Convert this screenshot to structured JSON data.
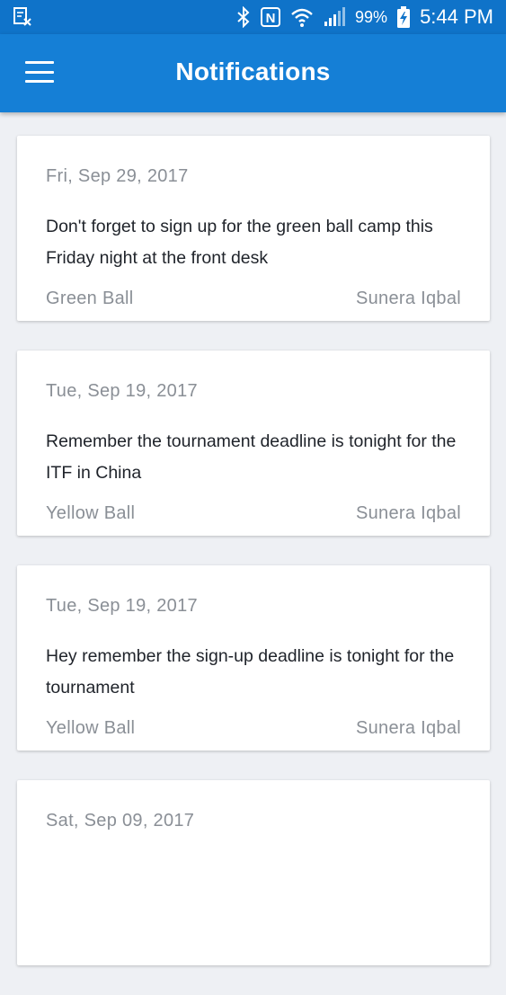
{
  "status_bar": {
    "battery": "99%",
    "time": "5:44 PM",
    "nfc_letter": "N"
  },
  "app_bar": {
    "title": "Notifications"
  },
  "notifications": [
    {
      "date": "Fri, Sep 29, 2017",
      "message": "Don't forget to sign up for the green ball camp this Friday night at the front desk",
      "group": "Green Ball",
      "author": "Sunera Iqbal"
    },
    {
      "date": "Tue, Sep 19, 2017",
      "message": "Remember the tournament deadline is tonight for the ITF in China",
      "group": "Yellow Ball",
      "author": "Sunera Iqbal"
    },
    {
      "date": "Tue, Sep 19, 2017",
      "message": "Hey remember the sign-up deadline is tonight for the tournament",
      "group": "Yellow Ball",
      "author": "Sunera Iqbal"
    },
    {
      "date": "Sat, Sep 09, 2017",
      "message": "",
      "group": "",
      "author": ""
    }
  ],
  "colors": {
    "status_bar": "#0f73c9",
    "app_bar": "#157fd6",
    "background": "#eef0f4"
  }
}
